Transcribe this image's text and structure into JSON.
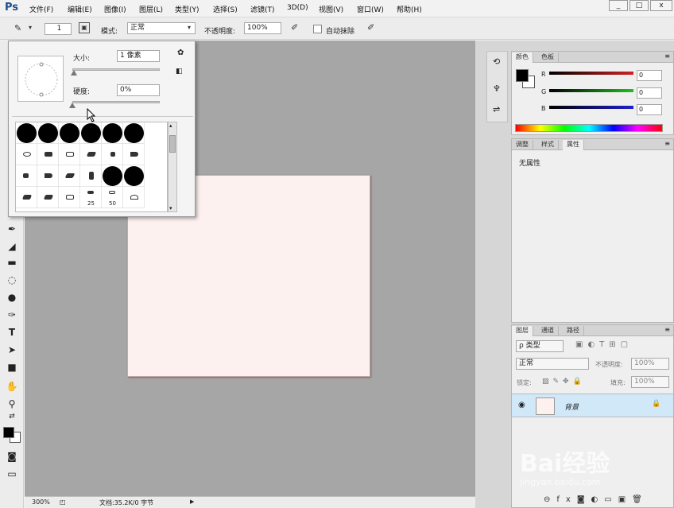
{
  "menubar": {
    "logo": "Ps",
    "items": [
      "文件(F)",
      "编辑(E)",
      "图像(I)",
      "图层(L)",
      "类型(Y)",
      "选择(S)",
      "滤镜(T)",
      "3D(D)",
      "视图(V)",
      "窗口(W)",
      "帮助(H)"
    ],
    "window_buttons": [
      "_",
      "□",
      "x"
    ]
  },
  "options": {
    "brush_size_value": "1",
    "mode_label": "模式:",
    "mode_value": "正常",
    "opacity_label": "不透明度:",
    "opacity_value": "100%",
    "auto_erase_label": "自动抹除"
  },
  "brush_popup": {
    "size_label": "大小:",
    "size_value": "1 像素",
    "hardness_label": "硬度:",
    "hardness_value": "0%",
    "size_level": 0.02,
    "hardness_level": 0.0,
    "grid_numbers": [
      "25",
      "50"
    ]
  },
  "color_panel": {
    "tabs": [
      "颜色",
      "色板"
    ],
    "r_label": "R",
    "g_label": "G",
    "b_label": "B",
    "r_value": "0",
    "g_value": "0",
    "b_value": "0",
    "colors": {
      "r": "#d42020",
      "g": "#20c020",
      "b": "#2020d0"
    }
  },
  "props_panel": {
    "tabs": [
      "调整",
      "样式",
      "属性"
    ],
    "content": "无属性"
  },
  "layers_panel": {
    "tabs": [
      "图层",
      "通道",
      "路径"
    ],
    "filter_label": "ρ 类型",
    "blend_mode": "正常",
    "opacity_label": "不透明度:",
    "opacity_value": "100%",
    "lock_label": "锁定:",
    "fill_label": "填充:",
    "fill_value": "100%",
    "layer_name": "背景"
  },
  "status": {
    "zoom": "300%",
    "doc": "文档:35.2K/0 字节"
  },
  "watermark": {
    "text": "Bai经验",
    "sub": "jingyan.baidu.com"
  }
}
